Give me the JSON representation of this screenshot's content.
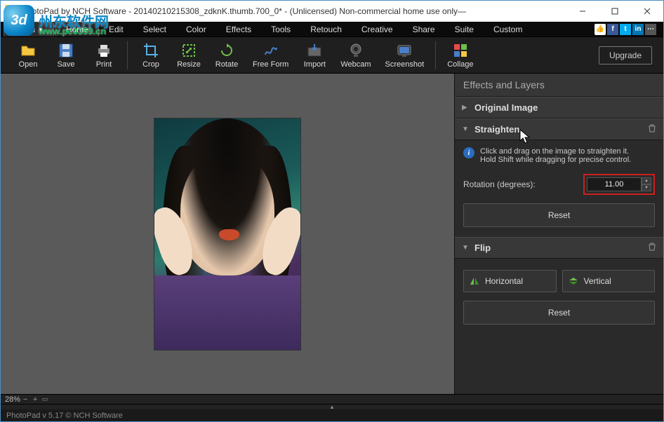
{
  "window": {
    "title": "PhotoPad by NCH Software - 20140210215308_zdknK.thumb.700_0* - (Unlicensed) Non-commercial home use only—"
  },
  "watermark": {
    "logo": "3d",
    "text": "州东软件网",
    "url": "www.pc0359.cn"
  },
  "menu": {
    "menu_label": "Menu",
    "tabs": [
      "Home",
      "Edit",
      "Select",
      "Color",
      "Effects",
      "Tools",
      "Retouch",
      "Creative",
      "Share",
      "Suite",
      "Custom"
    ],
    "active": "Home"
  },
  "toolbar": {
    "groups": [
      {
        "items": [
          {
            "name": "open-button",
            "label": "Open",
            "icon": "open"
          },
          {
            "name": "save-button",
            "label": "Save",
            "icon": "save"
          },
          {
            "name": "print-button",
            "label": "Print",
            "icon": "print"
          }
        ]
      },
      {
        "items": [
          {
            "name": "crop-button",
            "label": "Crop",
            "icon": "crop"
          },
          {
            "name": "resize-button",
            "label": "Resize",
            "icon": "resize"
          },
          {
            "name": "rotate-button",
            "label": "Rotate",
            "icon": "rotate"
          },
          {
            "name": "freeform-button",
            "label": "Free Form",
            "icon": "freeform"
          },
          {
            "name": "import-button",
            "label": "Import",
            "icon": "import"
          },
          {
            "name": "webcam-button",
            "label": "Webcam",
            "icon": "webcam"
          },
          {
            "name": "screenshot-button",
            "label": "Screenshot",
            "icon": "screenshot"
          }
        ]
      },
      {
        "items": [
          {
            "name": "collage-button",
            "label": "Collage",
            "icon": "collage"
          }
        ]
      }
    ],
    "upgrade": "Upgrade"
  },
  "panel": {
    "title": "Effects and Layers",
    "original": "Original Image",
    "straighten": {
      "title": "Straighten",
      "hint": "Click and drag on the image to straighten it.\nHold Shift while dragging for precise control.",
      "param_label": "Rotation (degrees):",
      "value": "11.00",
      "reset": "Reset"
    },
    "flip": {
      "title": "Flip",
      "horizontal": "Horizontal",
      "vertical": "Vertical",
      "reset": "Reset"
    }
  },
  "zoom": {
    "level": "28%"
  },
  "status": {
    "text": "PhotoPad v 5.17  © NCH Software"
  }
}
